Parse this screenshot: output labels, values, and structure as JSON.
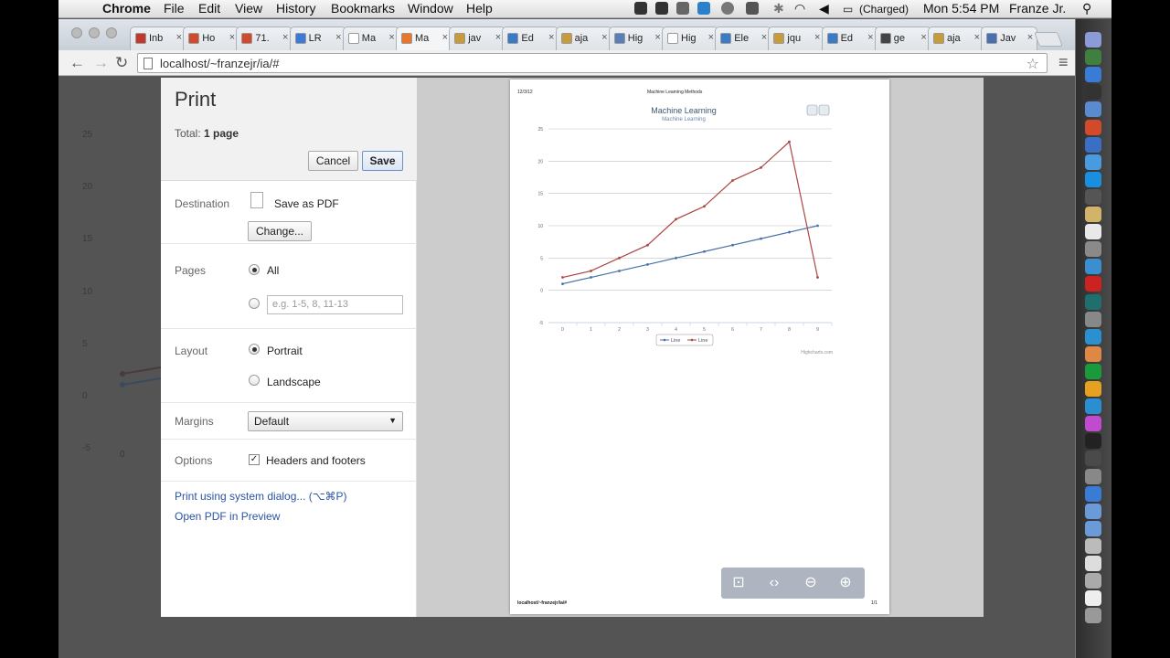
{
  "menubar": {
    "app_name": "Chrome",
    "menus": [
      "File",
      "Edit",
      "View",
      "History",
      "Bookmarks",
      "Window",
      "Help"
    ],
    "battery": "(Charged)",
    "clock": "Mon 5:54 PM",
    "user": "Franze Jr."
  },
  "tabs": [
    {
      "label": "Inb",
      "color": "#c0392b"
    },
    {
      "label": "Ho",
      "color": "#d04a2b"
    },
    {
      "label": "71.",
      "color": "#d04a2b"
    },
    {
      "label": "LR",
      "color": "#3c7ad6"
    },
    {
      "label": "Ma",
      "color": "#ffffff"
    },
    {
      "label": "Ma",
      "color": "#e8762b"
    },
    {
      "label": "jav",
      "color": "#c79a3a"
    },
    {
      "label": "Ed",
      "color": "#3a7bc8"
    },
    {
      "label": "aja",
      "color": "#c79a3a"
    },
    {
      "label": "Hig",
      "color": "#5a7fb8"
    },
    {
      "label": "Hig",
      "color": "#ffffff"
    },
    {
      "label": "Ele",
      "color": "#3a7bc8"
    },
    {
      "label": "jqu",
      "color": "#c79a3a"
    },
    {
      "label": "Ed",
      "color": "#3a7bc8"
    },
    {
      "label": "ge",
      "color": "#444444"
    },
    {
      "label": "aja",
      "color": "#c79a3a"
    },
    {
      "label": "Jav",
      "color": "#4a6fb0"
    }
  ],
  "toolbar": {
    "url": "localhost/~franzejr/ia/#"
  },
  "background_chart": {
    "y_ticks": [
      "25",
      "20",
      "15",
      "10",
      "5",
      "0",
      "-5"
    ],
    "x_first": "0"
  },
  "print": {
    "title": "Print",
    "total_label": "Total:",
    "total_value": "1 page",
    "cancel": "Cancel",
    "save": "Save",
    "destination_label": "Destination",
    "destination_value": "Save as PDF",
    "change": "Change...",
    "pages_label": "Pages",
    "pages_all": "All",
    "pages_placeholder": "e.g. 1-5, 8, 11-13",
    "layout_label": "Layout",
    "portrait": "Portrait",
    "landscape": "Landscape",
    "margins_label": "Margins",
    "margins_value": "Default",
    "options_label": "Options",
    "headers_footers": "Headers and footers",
    "system_dialog": "Print using system dialog... (⌥⌘P)",
    "open_pdf": "Open PDF in Preview"
  },
  "preview_page": {
    "header_date": "12/3/12",
    "header_title": "Machine Learning Methods",
    "footer_url": "localhost/~franzejr/ia/#",
    "footer_page": "1/1",
    "credits": "Highcharts.com"
  },
  "chart_data": {
    "type": "line",
    "title": "Machine Learning",
    "subtitle": "Machine Learning",
    "x": [
      0,
      1,
      2,
      3,
      4,
      5,
      6,
      7,
      8,
      9
    ],
    "ylim": [
      -5,
      25
    ],
    "y_ticks": [
      -5,
      0,
      5,
      10,
      15,
      20,
      25
    ],
    "grid": true,
    "legend": "bottom-center",
    "series": [
      {
        "name": "Line",
        "color": "#4572a7",
        "values": [
          1,
          2,
          3,
          4,
          5,
          6,
          7,
          8,
          9,
          10
        ]
      },
      {
        "name": "Line",
        "color": "#aa4643",
        "values": [
          2,
          3,
          5,
          7,
          11,
          13,
          17,
          19,
          23,
          2
        ]
      }
    ]
  }
}
